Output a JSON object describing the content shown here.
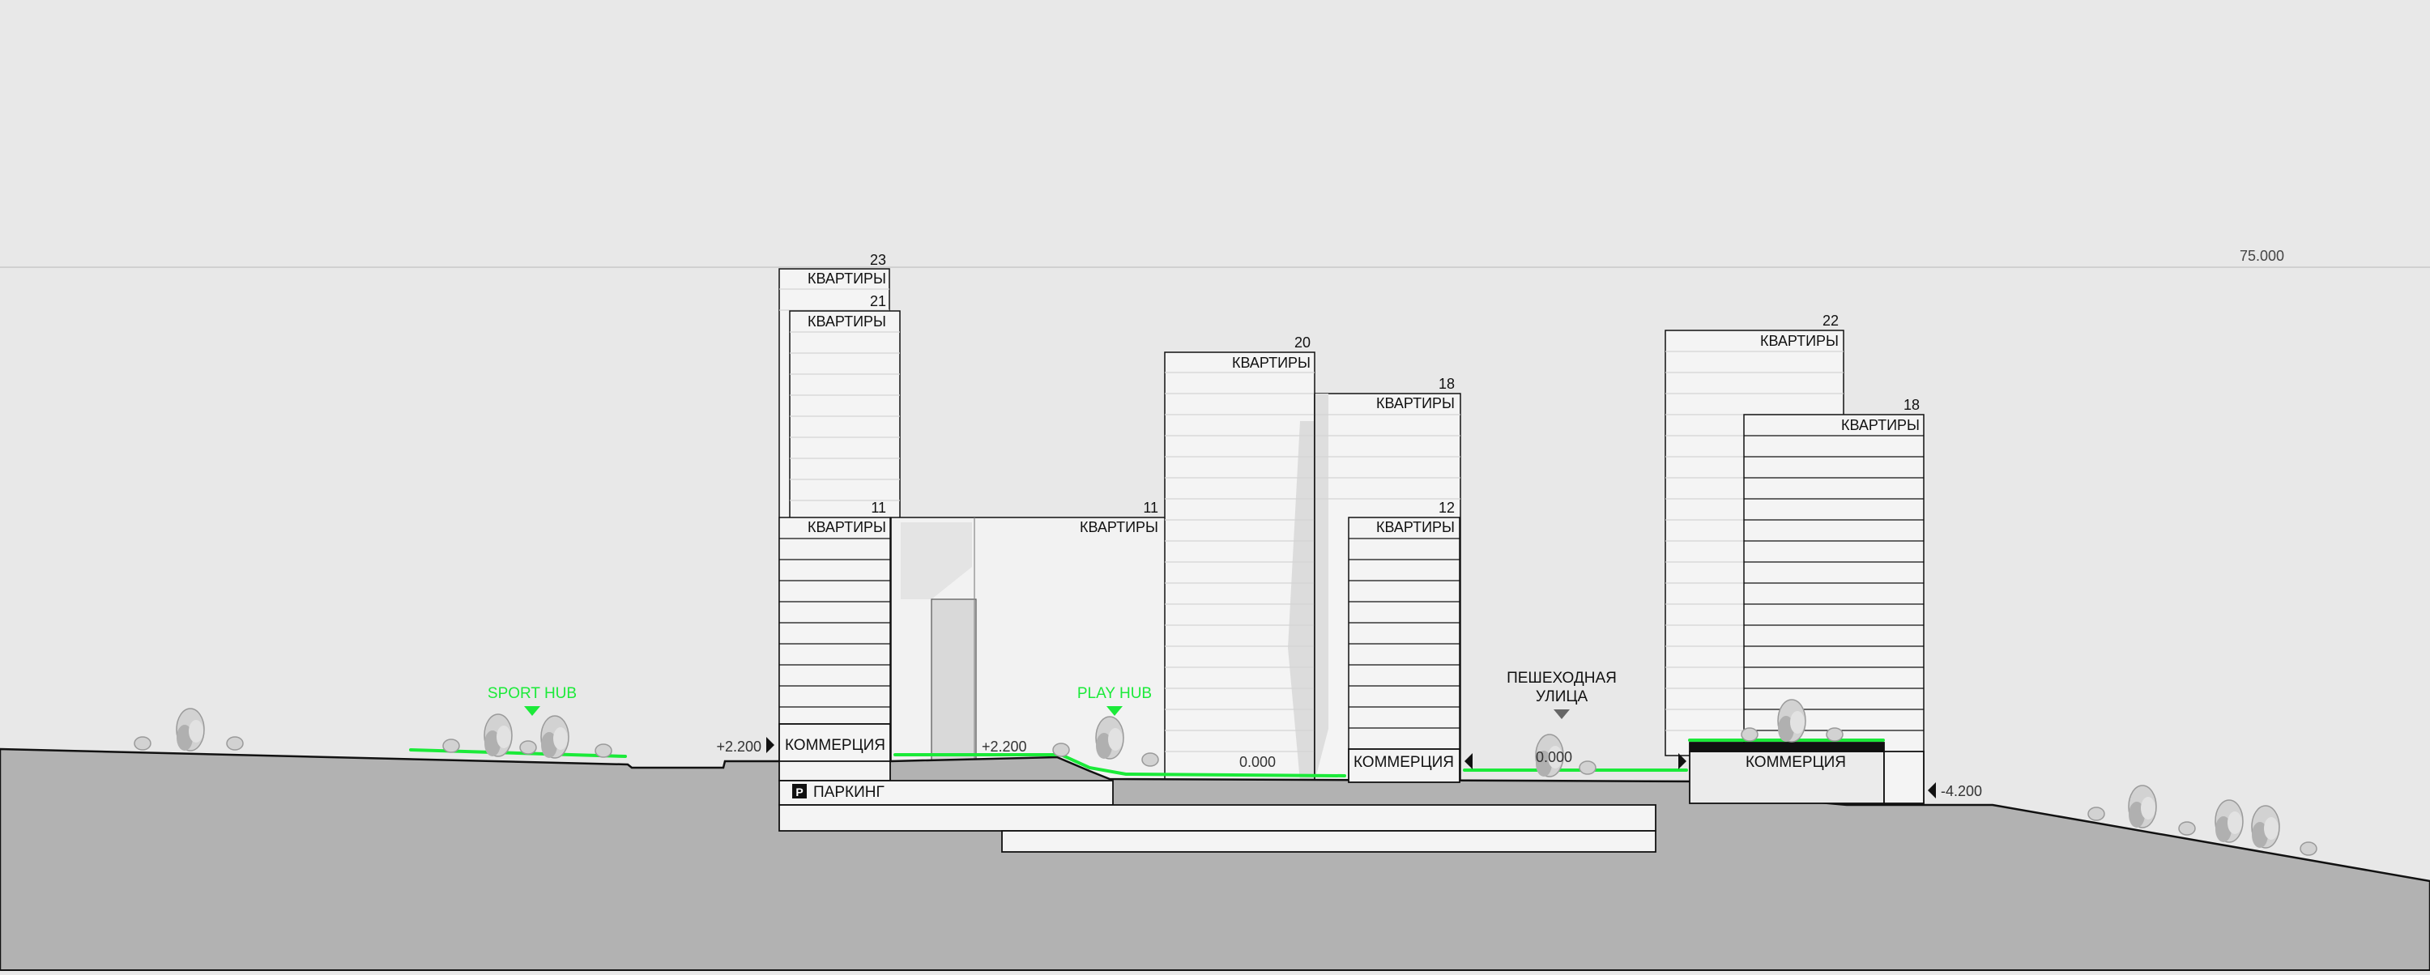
{
  "height_line": {
    "value": "75.000"
  },
  "buildings": [
    {
      "id": "tower-a1",
      "floors": "23",
      "label": "КВАРТИРЫ"
    },
    {
      "id": "tower-a2",
      "floors": "21",
      "label": "КВАРТИРЫ"
    },
    {
      "id": "block-a-low",
      "floors": "11",
      "label": "КВАРТИРЫ"
    },
    {
      "id": "block-mid",
      "floors": "11",
      "label": "КВАРТИРЫ"
    },
    {
      "id": "tower-b",
      "floors": "20",
      "label": "КВАРТИРЫ"
    },
    {
      "id": "tower-c",
      "floors": "18",
      "label": "КВАРТИРЫ"
    },
    {
      "id": "block-c-low",
      "floors": "12",
      "label": "КВАРТИРЫ"
    },
    {
      "id": "tower-d",
      "floors": "22",
      "label": "КВАРТИРЫ"
    },
    {
      "id": "tower-e",
      "floors": "18",
      "label": "КВАРТИРЫ"
    }
  ],
  "podiums": {
    "commerce_label": "КОММЕРЦИЯ",
    "parking_label": "ПАРКИНГ",
    "parking_icon": "P"
  },
  "levels": {
    "left_terrace": "+2.200",
    "courtyard": "+2.200",
    "ground_mid": "0.000",
    "ground_street": "0.000",
    "lower_right": "-4.200"
  },
  "hubs": {
    "sport": "SPORT HUB",
    "play": "PLAY HUB"
  },
  "street": {
    "line1": "ПЕШЕХОДНАЯ",
    "line2": "УЛИЦА"
  },
  "colors": {
    "background": "#e8e8e8",
    "ground": "#b2b2b2",
    "accent_green": "#1bea39",
    "building_fill": "#f4f4f4",
    "line": "#111111"
  },
  "icons": [
    "tree-icon",
    "marker-down-icon",
    "level-marker-icon",
    "parking-icon"
  ]
}
